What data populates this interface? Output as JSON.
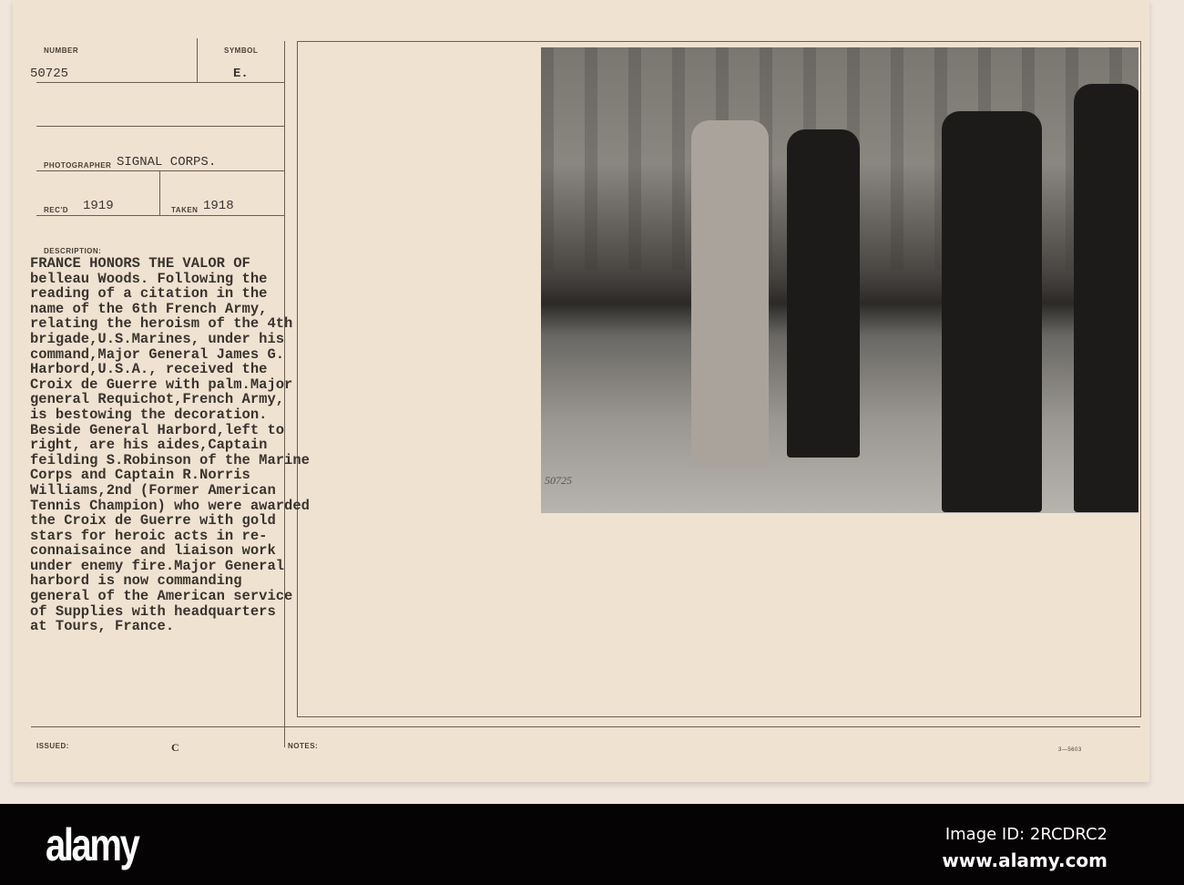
{
  "card": {
    "number_label": "NUMBER",
    "number": "50725",
    "symbol_label": "SYMBOL",
    "symbol": "E.",
    "photographer_label": "PHOTOGRAPHER",
    "photographer": "SIGNAL CORPS.",
    "recd_label": "REC'D",
    "recd": "1919",
    "taken_label": "TAKEN",
    "taken": "1918",
    "description_label": "DESCRIPTION:",
    "description_lines": [
      "FRANCE HONORS THE VALOR OF",
      "belleau Woods. Following the",
      "reading of a citation in the",
      "name of the 6th French Army,",
      "relating the heroism of the 4th",
      "brigade,U.S.Marines, under his",
      "command,Major General James G.",
      "Harbord,U.S.A., received the",
      "Croix de Guerre with palm.Major",
      "general Requichot,French Army,",
      "is bestowing the decoration.",
      "Beside General Harbord,left to",
      "right, are his aides,Captain",
      "feilding S.Robinson of the Marine",
      "Corps and Captain R.Norris",
      "Williams,2nd (Former American",
      "Tennis Champion) who were awarded",
      "the Croix de Guerre with gold",
      "stars for heroic acts in re-",
      "connaisaince and liaison work",
      "under enemy fire.Major General",
      "harbord is now commanding",
      "general of the American service",
      "of Supplies with headquarters",
      "at Tours, France."
    ],
    "issued_label": "ISSUED:",
    "issued_mark": "C",
    "notes_label": "NOTES:",
    "form_number": "3—5603",
    "photo_stamp": "50725"
  },
  "watermark": {
    "logo": "alamy",
    "image_id": "Image ID: 2RCDRC2",
    "site": "www.alamy.com"
  }
}
